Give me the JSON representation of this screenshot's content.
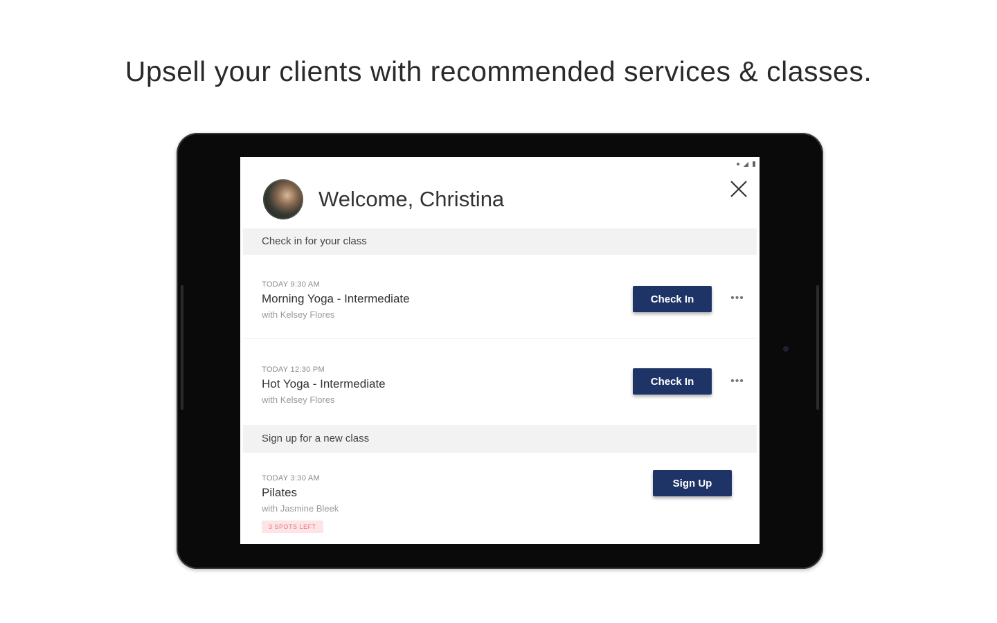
{
  "headline": "Upsell your clients with recommended services & classes.",
  "screen": {
    "welcome_title": "Welcome, Christina",
    "check_in_section": "Check in for your class",
    "signup_section": "Sign up for a new class",
    "classes_checkin": [
      {
        "time": "TODAY 9:30 AM",
        "name": "Morning Yoga - Intermediate",
        "instructor": "with Kelsey Flores",
        "button": "Check In",
        "more": "•••"
      },
      {
        "time": "TODAY 12:30 PM",
        "name": "Hot Yoga - Intermediate",
        "instructor": "with Kelsey Flores",
        "button": "Check In",
        "more": "•••"
      }
    ],
    "classes_signup": [
      {
        "time": "TODAY 3:30 AM",
        "name": "Pilates",
        "instructor": "with Jasmine Bleek",
        "badge": "3 SPOTS LEFT",
        "button": "Sign Up"
      }
    ]
  },
  "colors": {
    "primary_button": "#1f3466",
    "section_bg": "#f2f2f2",
    "badge_bg": "#fde4e6",
    "badge_text": "#e57b86"
  },
  "icons": {
    "close": "close-icon",
    "more": "more-options-icon"
  }
}
